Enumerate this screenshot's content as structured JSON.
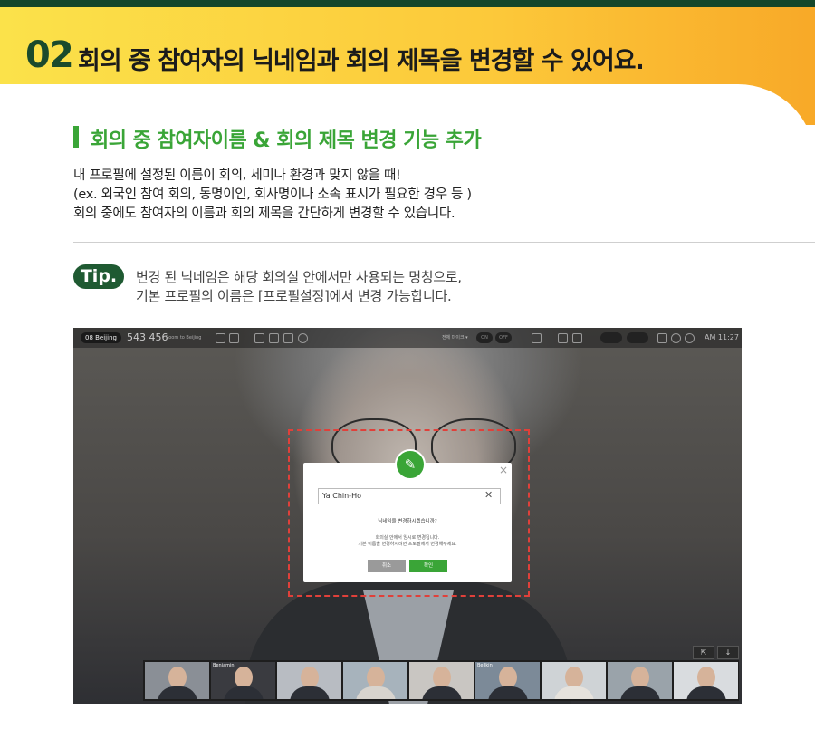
{
  "banner": {
    "number": "02",
    "title": "회의 중 참여자의 닉네임과 회의 제목을 변경할 수 있어요."
  },
  "section": {
    "title": "회의 중 참여자이름 & 회의 제목 변경 기능 추가",
    "lines": [
      "내 프로필에 설정된 이름이 회의, 세미나 환경과 맞지 않을 때!",
      "(ex. 외국인 참여 회의, 동명이인, 회사명이나 소속 표시가 필요한 경우 등 )",
      "회의 중에도 참여자의 이름과 회의 제목을 간단하게 변경할 수 있습니다."
    ]
  },
  "tip": {
    "badge": "Tip.",
    "lines": [
      "변경 된 닉네임은 해당 회의실 안에서만 사용되는 명칭으로,",
      "기본 프로필의 이름은 [프로필설정]에서 변경 가능합니다."
    ]
  },
  "screenshot": {
    "toolbar": {
      "room_badge": "08 Beijing",
      "room_number": "543 456",
      "room_name": "Room to Beijing",
      "all_mute_label": "전체 마이크 ▾",
      "on_label": "ON",
      "off_label": "OFF",
      "clock": "AM 11:27"
    },
    "dialog": {
      "edit_icon": "pencil-icon",
      "input_value": "Ya Chin-Ho",
      "question": "닉네임을 변경하시겠습니까?",
      "note_line1": "회의실 안에서 임시로 변경됩니다.",
      "note_line2": "기본 이름을 변경하시려면 프로필에서 변경해주세요.",
      "cancel_label": "취소",
      "confirm_label": "확인"
    },
    "thumbnails": [
      {
        "label": ""
      },
      {
        "label": "Benjamin"
      },
      {
        "label": ""
      },
      {
        "label": ""
      },
      {
        "label": ""
      },
      {
        "label": "Bellkin"
      },
      {
        "label": ""
      },
      {
        "label": ""
      },
      {
        "label": ""
      }
    ]
  },
  "colors": {
    "accent_green": "#3aa537",
    "dark_green": "#1f5a32",
    "dash_red": "#e0403a"
  }
}
